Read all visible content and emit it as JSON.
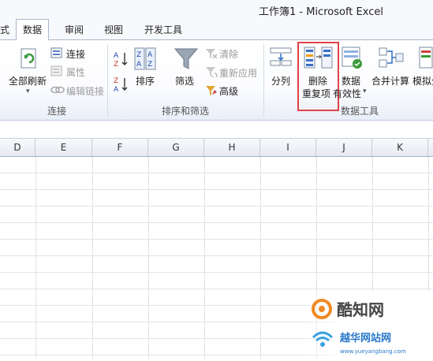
{
  "window": {
    "title": "工作簿1  -  Microsoft Excel"
  },
  "tabs": [
    "式",
    "数据",
    "审阅",
    "视图",
    "开发工具"
  ],
  "active_tab": "数据",
  "ribbon": {
    "groups": {
      "connections": {
        "label": "连接",
        "refresh_all": "全部刷新",
        "connections": "连接",
        "properties": "属性",
        "edit_links": "编辑链接"
      },
      "sort_filter": {
        "label": "排序和筛选",
        "sort": "排序",
        "filter": "筛选",
        "clear": "清除",
        "reapply": "重新应用",
        "advanced": "高级"
      },
      "data_tools": {
        "label": "数据工具",
        "text_to_columns": "分列",
        "remove_dup_1": "删除",
        "remove_dup_2": "重复项",
        "validation_1": "数据",
        "validation_2": "有效性",
        "consolidate": "合并计算",
        "whatif": "模拟分"
      }
    }
  },
  "columns": [
    "D",
    "E",
    "F",
    "G",
    "H",
    "I",
    "J",
    "K"
  ],
  "watermark": {
    "brand": "酷知网",
    "site": "越华网站网",
    "url": "www.yueyangbang.com"
  },
  "colors": {
    "highlight": "#e0424a",
    "tab_border": "#aab8cc"
  }
}
